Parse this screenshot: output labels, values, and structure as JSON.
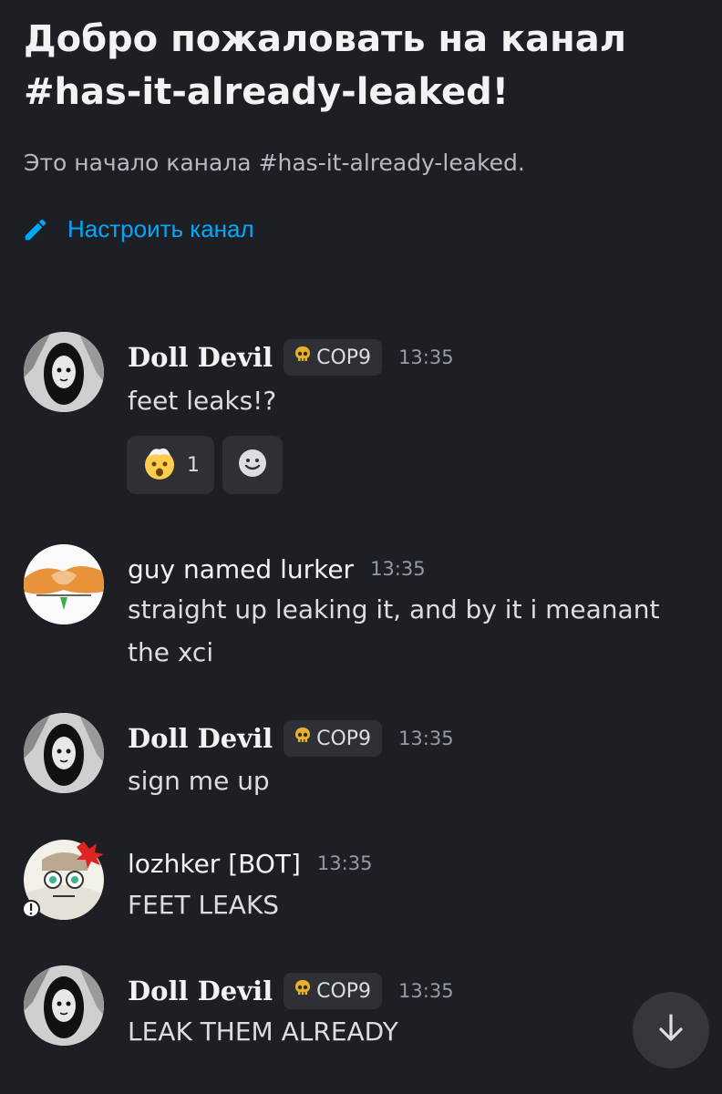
{
  "channel": {
    "welcome_title": "Добро пожаловать на канал #has-it-already-leaked!",
    "welcome_subtitle": "Это начало канала #has-it-already-leaked.",
    "edit_link_label": "Настроить канал",
    "edit_icon": "pencil-icon"
  },
  "messages": [
    {
      "username": "Doll Devil",
      "tag": "COP9",
      "tag_icon": "skull-icon",
      "time": "13:35",
      "text": "feet leaks!?",
      "reaction": {
        "emoji": "mind-blown-emoji",
        "count": "1"
      },
      "add_reaction_icon": "smiley-icon"
    },
    {
      "username": "guy named lurker",
      "time": "13:35",
      "text": "straight up leaking it, and by it i meanant the xci"
    },
    {
      "username": "Doll Devil",
      "tag": "COP9",
      "tag_icon": "skull-icon",
      "time": "13:35",
      "text": "sign me up"
    },
    {
      "username": "lozhker [BOT]",
      "time": "13:35",
      "text": "FEET LEAKS"
    },
    {
      "username": "Doll Devil",
      "tag": "COP9",
      "tag_icon": "skull-icon",
      "time": "13:35",
      "text": "LEAK THEM ALREADY"
    }
  ],
  "scroll_button_icon": "arrow-down-icon",
  "colors": {
    "background": "#1e1f24",
    "link": "#00a8fc",
    "tag_background": "#2e3035",
    "timestamp": "#949ba4"
  }
}
